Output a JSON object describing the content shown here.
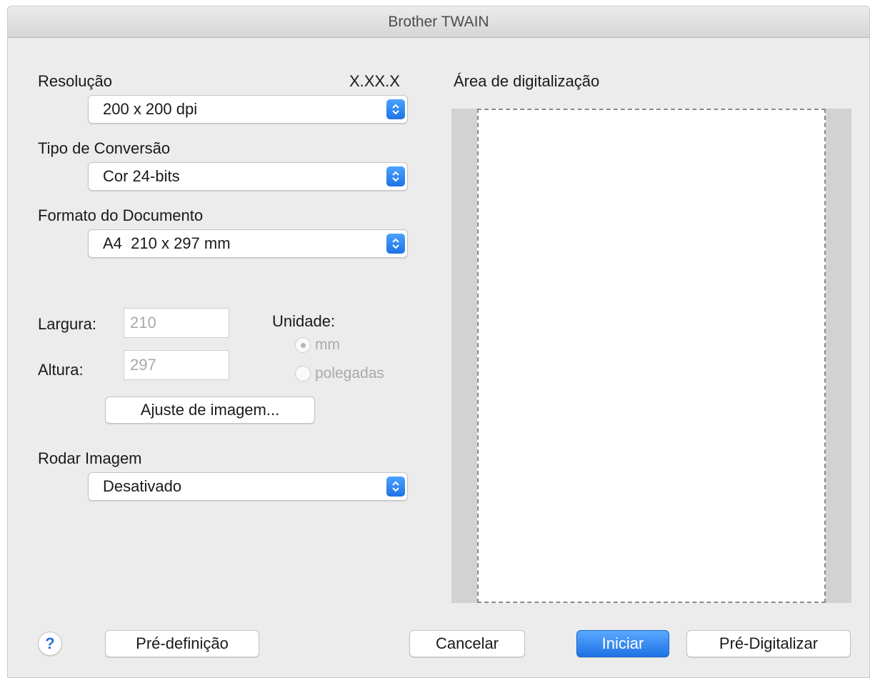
{
  "window": {
    "title": "Brother TWAIN"
  },
  "resolution": {
    "label": "Resolução",
    "version": "X.XX.X",
    "value": "200 x 200 dpi"
  },
  "conversion": {
    "label": "Tipo de Conversão",
    "value": "Cor 24-bits"
  },
  "doc_format": {
    "label": "Formato do Documento",
    "value": "A4  210 x 297 mm"
  },
  "size": {
    "width_label": "Largura:",
    "width_value": "210",
    "height_label": "Altura:",
    "height_value": "297"
  },
  "unit": {
    "label": "Unidade:",
    "options": [
      {
        "label": "mm",
        "selected": true
      },
      {
        "label": "polegadas",
        "selected": false
      }
    ]
  },
  "image_adjust": {
    "label": "Ajuste de imagem..."
  },
  "rotate": {
    "label": "Rodar Imagem",
    "value": "Desativado"
  },
  "scan_area": {
    "label": "Área de digitalização"
  },
  "footer": {
    "help": "?",
    "preset": "Pré-definição",
    "cancel": "Cancelar",
    "start": "Iniciar",
    "prescan": "Pré-Digitalizar"
  },
  "colors": {
    "accent": "#1e72e5",
    "window_bg": "#ececec",
    "disabled_text": "#a9a9a9"
  },
  "icons": {
    "stepper": "chevron-up-down-icon",
    "help": "help-icon"
  }
}
